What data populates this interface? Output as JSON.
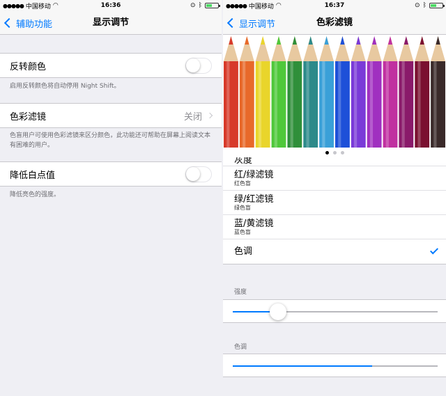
{
  "left": {
    "status": {
      "carrier": "中国移动",
      "time": "16:36",
      "battery_level": 0.5
    },
    "nav": {
      "back_label": "辅助功能",
      "title": "显示调节"
    },
    "invert": {
      "label": "反转颜色",
      "on": false,
      "footer": "启用反转颜色将自动停用 Night Shift。"
    },
    "color_filters": {
      "label": "色彩滤镜",
      "value": "关闭",
      "footer": "色盲用户可使用色彩滤镜来区分颜色，此功能还可帮助在屏幕上阅读文本有困难的用户。"
    },
    "reduce_white_point": {
      "label": "降低白点值",
      "on": false,
      "footer": "降低亮色的强度。"
    }
  },
  "right": {
    "status": {
      "carrier": "中国移动",
      "time": "16:37",
      "battery_level": 0.5
    },
    "nav": {
      "back_label": "显示调节",
      "title": "色彩滤镜"
    },
    "pencil_colors": [
      "#d73a2a",
      "#e8692a",
      "#e9d52b",
      "#4fc83a",
      "#2f8f3a",
      "#2c8a8a",
      "#3aa0d8",
      "#1e50d8",
      "#7a3ad8",
      "#a030c0",
      "#c030a0",
      "#8a1a6a",
      "#7a1030",
      "#3a2a2a"
    ],
    "pager": {
      "count": 3,
      "active": 0
    },
    "filters": [
      {
        "title": "灰度",
        "subtitle": "",
        "partial": true
      },
      {
        "title": "红/绿滤镜",
        "subtitle": "红色盲"
      },
      {
        "title": "绿/红滤镜",
        "subtitle": "绿色盲"
      },
      {
        "title": "蓝/黄滤镜",
        "subtitle": "蓝色盲"
      },
      {
        "title": "色调",
        "subtitle": "",
        "selected": true
      }
    ],
    "intensity": {
      "label": "强度",
      "value": 0.22
    },
    "hue": {
      "label": "色调",
      "value": 0.68
    }
  }
}
